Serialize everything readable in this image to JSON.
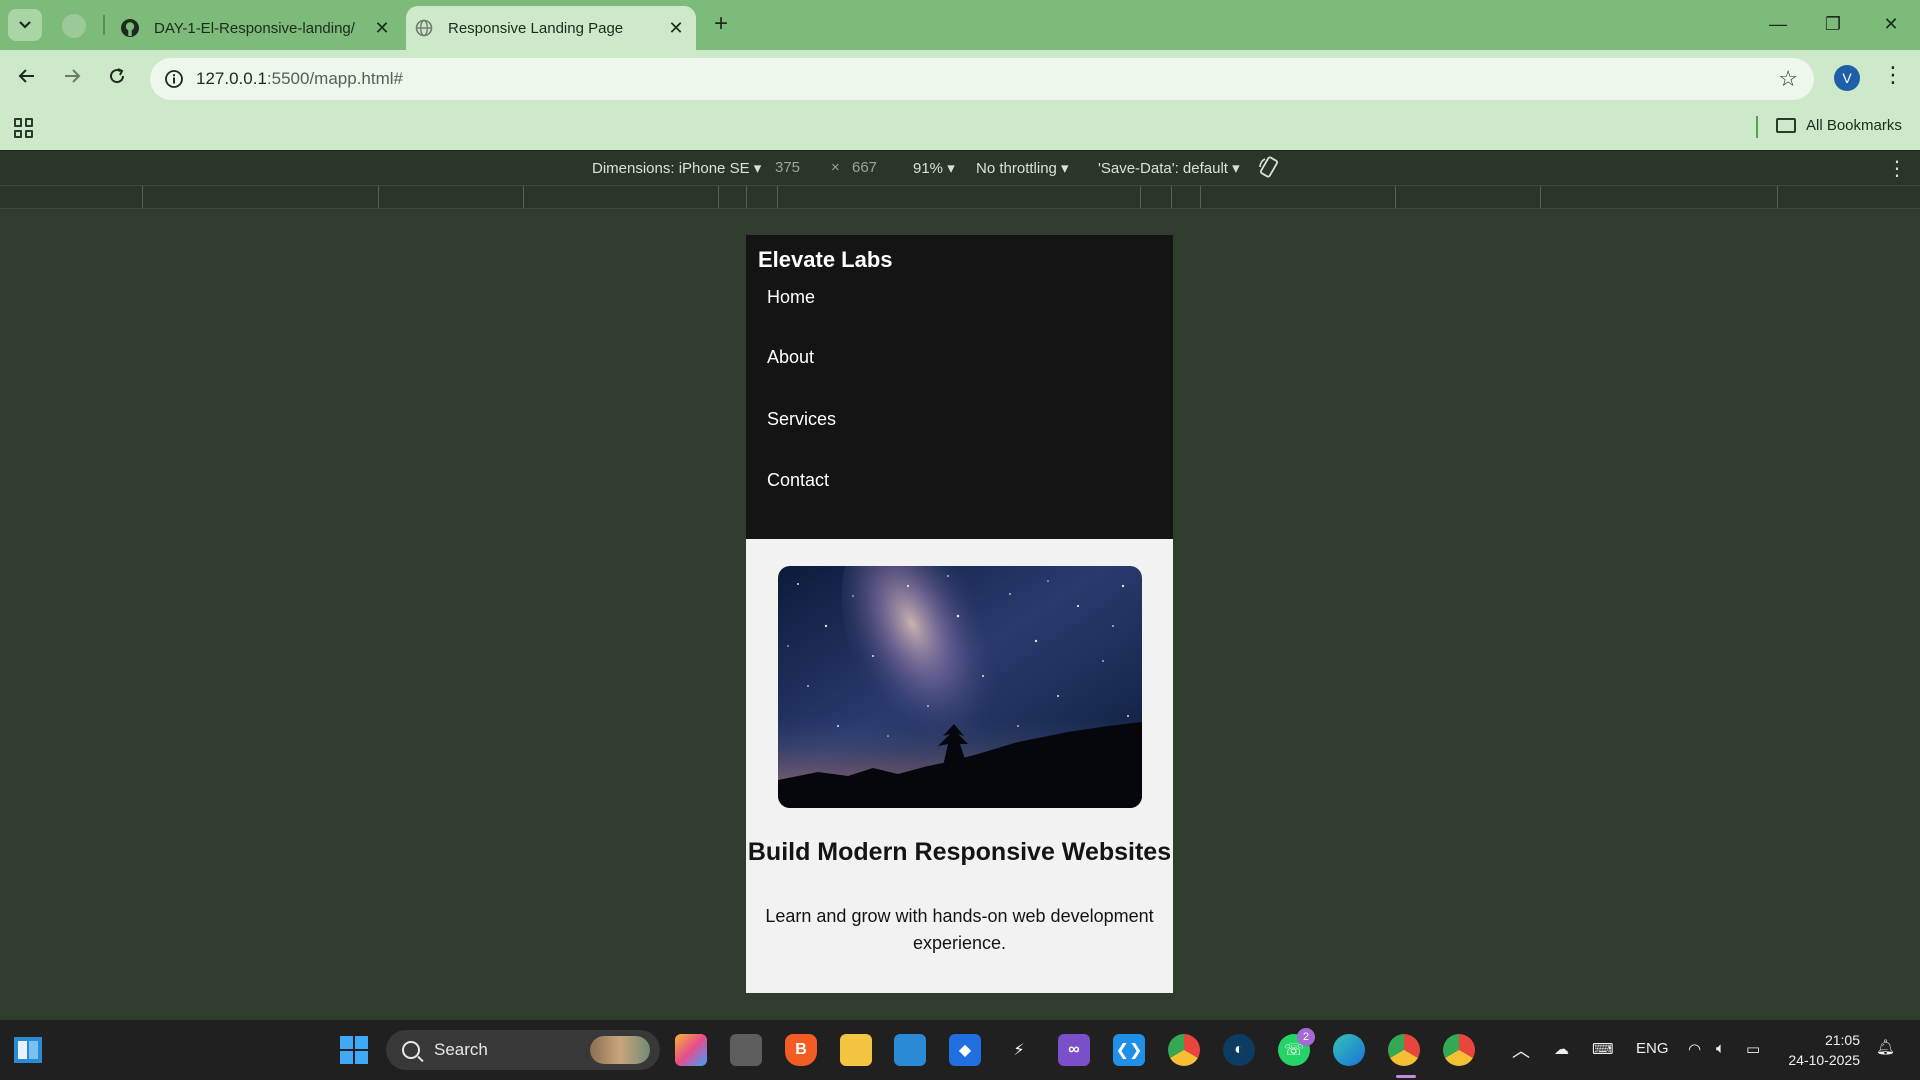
{
  "browser": {
    "tabs": [
      {
        "title": "DAY-1-El-Responsive-landing/",
        "close": "✕"
      },
      {
        "title": "Responsive Landing Page",
        "close": "✕"
      }
    ],
    "new_tab": "+",
    "window": {
      "minimize": "—",
      "restore": "❐",
      "close": "✕"
    },
    "url_host": "127.0.0.1",
    "url_rest": ":5500/mapp.html#",
    "profile_initial": "V",
    "bookmarks_label": "All Bookmarks"
  },
  "devtools": {
    "dimensions": "Dimensions: iPhone SE ▾",
    "width": "375",
    "times": "×",
    "height": "667",
    "zoom": "91% ▾",
    "throttling": "No throttling ▾",
    "save_data": "'Save-Data': default ▾"
  },
  "site": {
    "brand": "Elevate Labs",
    "nav": [
      "Home",
      "About",
      "Services",
      "Contact"
    ],
    "hero_title": "Build Modern Responsive Websites",
    "hero_text": "Learn and grow with hands-on web development experience."
  },
  "taskbar": {
    "search_label": "Search",
    "whatsapp_badge": "2",
    "language": "ENG",
    "time": "21:05",
    "date": "24-10-2025"
  },
  "colors": {
    "tab_strip": "#7dbb7a",
    "toolbar": "#cde9c9",
    "devtools_bg": "#2f3c2e",
    "site_nav": "#141414",
    "site_bg": "#f2f2f2"
  }
}
